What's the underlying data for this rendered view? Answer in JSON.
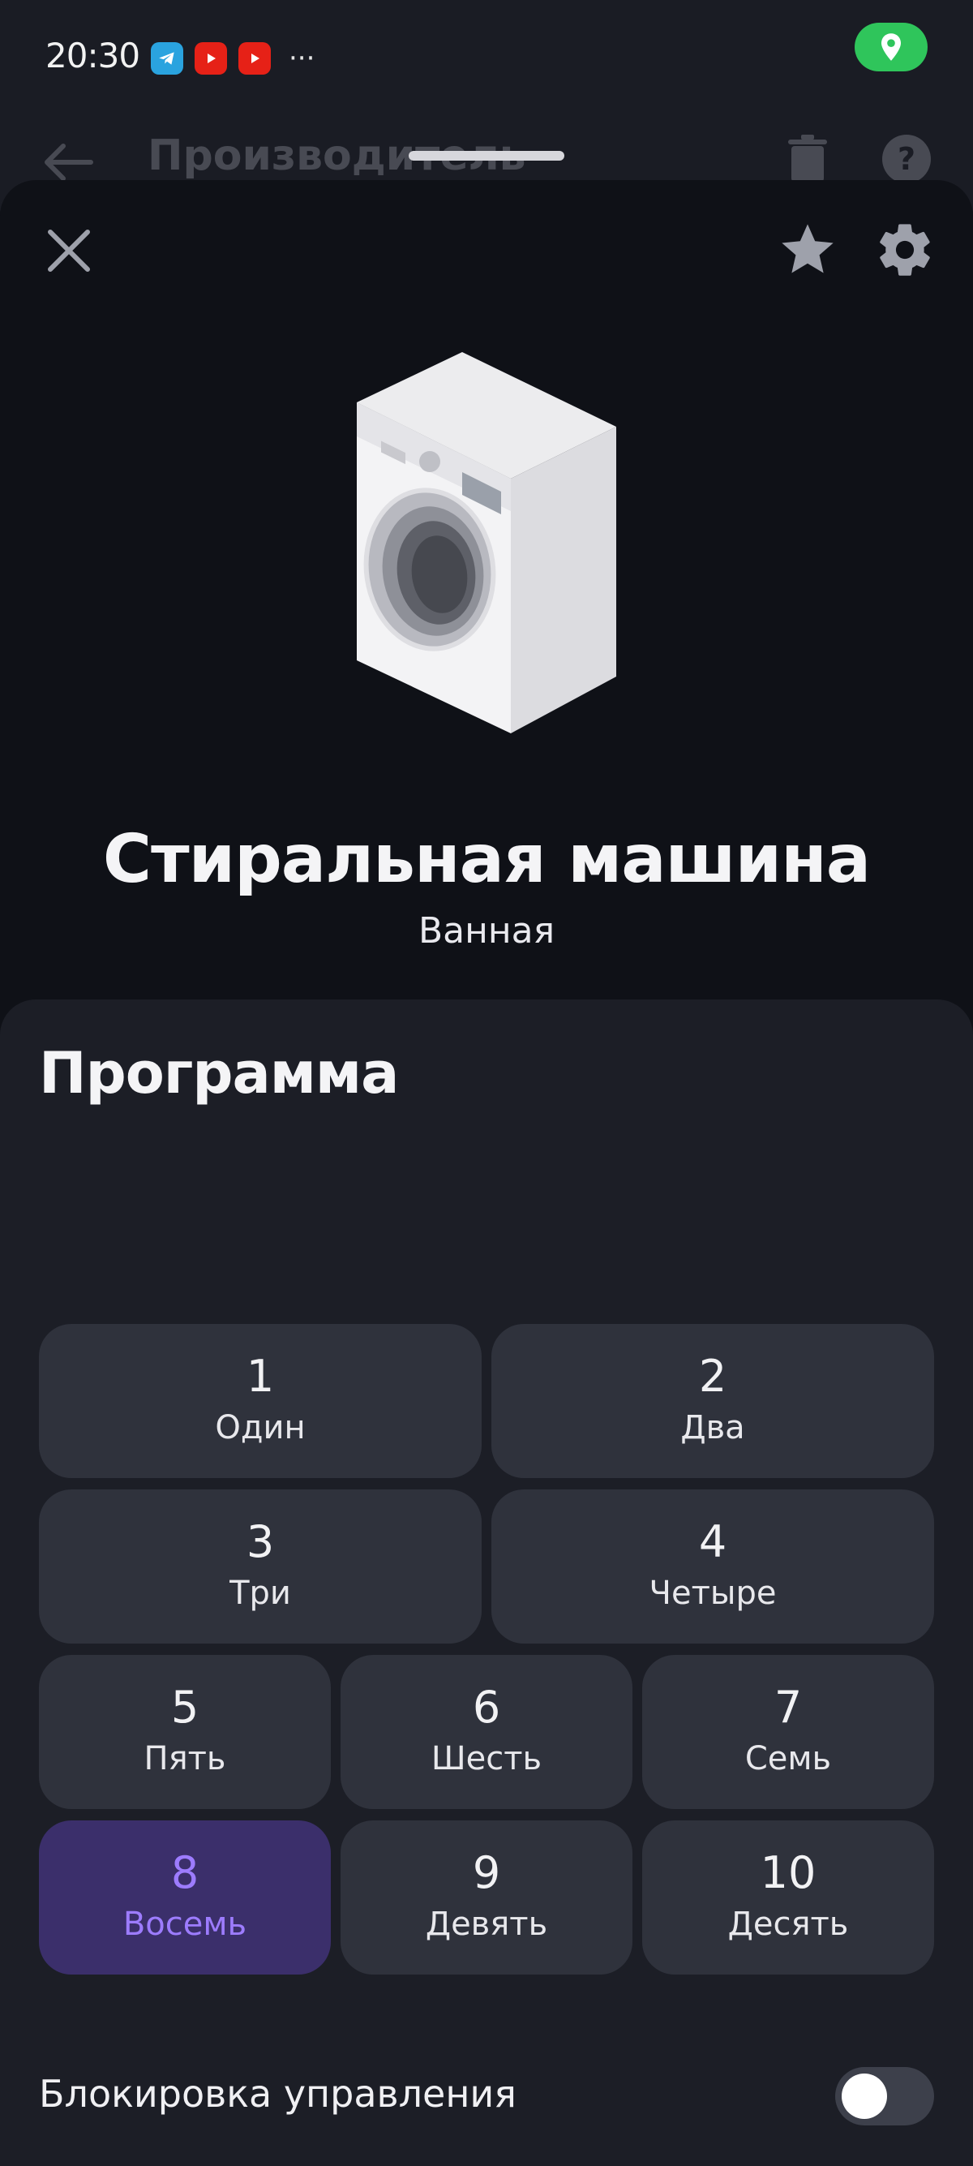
{
  "status_bar": {
    "time": "20:30",
    "app_icons": [
      "telegram-icon",
      "youtube-icon",
      "youtube-icon"
    ],
    "overflow": "···",
    "location_color": "#2fc55b"
  },
  "underlying_page": {
    "title": "Производитель"
  },
  "device": {
    "name": "Стиральная машина",
    "room": "Ванная"
  },
  "program": {
    "title": "Программа",
    "selected": "8",
    "accent_color": "#9d7cff",
    "items": [
      {
        "num": "1",
        "label": "Один"
      },
      {
        "num": "2",
        "label": "Два"
      },
      {
        "num": "3",
        "label": "Три"
      },
      {
        "num": "4",
        "label": "Четыре"
      },
      {
        "num": "5",
        "label": "Пять"
      },
      {
        "num": "6",
        "label": "Шесть"
      },
      {
        "num": "7",
        "label": "Семь"
      },
      {
        "num": "8",
        "label": "Восемь"
      },
      {
        "num": "9",
        "label": "Девять"
      },
      {
        "num": "10",
        "label": "Десять"
      }
    ]
  },
  "lock": {
    "label": "Блокировка управления",
    "enabled": false
  }
}
